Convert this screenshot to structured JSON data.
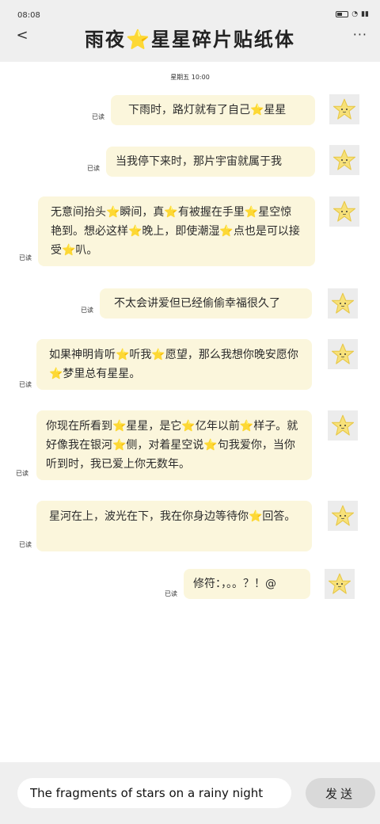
{
  "status_bar": {
    "time": "08:08"
  },
  "header": {
    "title": "雨夜⭐星星碎片贴纸体"
  },
  "timestamp": "星期五 10:00",
  "read_label": "已读",
  "messages": [
    {
      "text": "下雨时，路灯就有了自己⭐星星"
    },
    {
      "text": "当我停下来时，那片宇宙就属于我"
    },
    {
      "text": "无意间抬头⭐瞬间，真⭐有被握在手里⭐星空惊艳到。想必这样⭐晚上，即使潮湿⭐点也是可以接受⭐叭。"
    },
    {
      "text": "不太会讲爱但已经偷偷幸福很久了"
    },
    {
      "text": "如果神明肯听⭐听我⭐愿望，那么我想你晚安愿你⭐梦里总有星星。"
    },
    {
      "text": "你现在所看到⭐星星，是它⭐亿年以前⭐样子。就好像我在银河⭐侧，对着星空说⭐句我爱你，当你听到时，我已爱上你无数年。"
    },
    {
      "text": "星河在上，波光在下，我在你身边等待你⭐回答。"
    },
    {
      "text": "修符：，。。？！@"
    }
  ],
  "input": {
    "value": "The fragments of stars on a rainy night"
  },
  "send_label": "发送"
}
